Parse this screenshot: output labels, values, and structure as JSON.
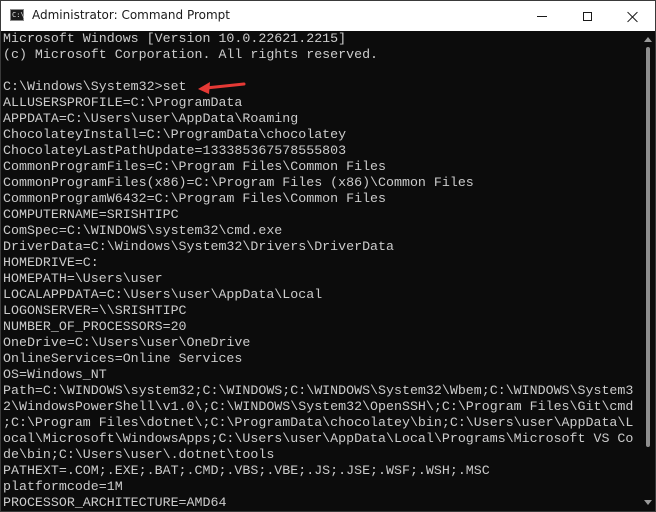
{
  "window": {
    "title": "Administrator: Command Prompt",
    "icon": "cmd-icon",
    "icon_glyph": "C:\\",
    "controls": [
      "minimize-icon",
      "maximize-icon",
      "close-icon"
    ]
  },
  "annotation": {
    "icon": "red-arrow-icon",
    "color": "#e53935"
  },
  "console": {
    "lines": [
      "Microsoft Windows [Version 10.0.22621.2215]",
      "(c) Microsoft Corporation. All rights reserved.",
      "",
      "C:\\Windows\\System32>set",
      "ALLUSERSPROFILE=C:\\ProgramData",
      "APPDATA=C:\\Users\\user\\AppData\\Roaming",
      "ChocolateyInstall=C:\\ProgramData\\chocolatey",
      "ChocolateyLastPathUpdate=133385367578555803",
      "CommonProgramFiles=C:\\Program Files\\Common Files",
      "CommonProgramFiles(x86)=C:\\Program Files (x86)\\Common Files",
      "CommonProgramW6432=C:\\Program Files\\Common Files",
      "COMPUTERNAME=SRISHTIPC",
      "ComSpec=C:\\WINDOWS\\system32\\cmd.exe",
      "DriverData=C:\\Windows\\System32\\Drivers\\DriverData",
      "HOMEDRIVE=C:",
      "HOMEPATH=\\Users\\user",
      "LOCALAPPDATA=C:\\Users\\user\\AppData\\Local",
      "LOGONSERVER=\\\\SRISHTIPC",
      "NUMBER_OF_PROCESSORS=20",
      "OneDrive=C:\\Users\\user\\OneDrive",
      "OnlineServices=Online Services",
      "OS=Windows_NT",
      "Path=C:\\WINDOWS\\system32;C:\\WINDOWS;C:\\WINDOWS\\System32\\Wbem;C:\\WINDOWS\\System3",
      "2\\WindowsPowerShell\\v1.0\\;C:\\WINDOWS\\System32\\OpenSSH\\;C:\\Program Files\\Git\\cmd",
      ";C:\\Program Files\\dotnet\\;C:\\ProgramData\\chocolatey\\bin;C:\\Users\\user\\AppData\\L",
      "ocal\\Microsoft\\WindowsApps;C:\\Users\\user\\AppData\\Local\\Programs\\Microsoft VS Co",
      "de\\bin;C:\\Users\\user\\.dotnet\\tools",
      "PATHEXT=.COM;.EXE;.BAT;.CMD;.VBS;.VBE;.JS;.JSE;.WSF;.WSH;.MSC",
      "platformcode=1M",
      "PROCESSOR_ARCHITECTURE=AMD64"
    ]
  }
}
